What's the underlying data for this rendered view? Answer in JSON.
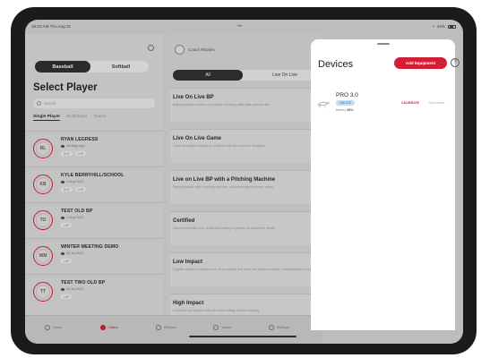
{
  "status_bar": {
    "time": "10:23 AM  Thu Aug 31",
    "wifi": "•",
    "battery": "44%"
  },
  "left": {
    "sport_toggle": [
      "Baseball",
      "Softball"
    ],
    "title": "Select Player",
    "search_placeholder": "Search",
    "filters": [
      "Single Player",
      "Multiplayer",
      "Teams"
    ],
    "players": [
      {
        "name": "RYAN LEGRESS",
        "meta": "44 days ago",
        "chips": [
          "RHP",
          "LHP"
        ]
      },
      {
        "name": "KYLE BERRYHILL/SCHOOL",
        "meta": "2 Aug 2023",
        "chips": [
          "RHP",
          "LHP"
        ]
      },
      {
        "name": "TEST OLD BP",
        "meta": "1 Aug 2023",
        "chips": [
          "LHP"
        ]
      },
      {
        "name": "WINTER MEETING DEMO",
        "meta": "25 Jul 2023",
        "chips": [
          "LHP"
        ]
      },
      {
        "name": "TEST TWO OLD BP",
        "meta": "24 Jul 2023",
        "chips": [
          "LHP"
        ]
      }
    ]
  },
  "mid": {
    "user": "Coach Rhodes",
    "tabs": [
      "All",
      "Live On Live"
    ],
    "modes": [
      {
        "title": "Live On Live BP",
        "desc": "Batting practice session vs a pitcher throwing, pitch data captured live"
      },
      {
        "title": "Live On Live Game",
        "desc": "Game-simulation session vs a pitcher with full count and situations"
      },
      {
        "title": "Live on Live BP with a Pitching Machine",
        "desc": "Batting practice with a pitching machine, outcomes captured each swing"
      },
      {
        "title": "Certified",
        "desc": "Swing certification test, a standard battery of pitches\nfor consistent results"
      },
      {
        "title": "Low Impact",
        "desc": "A lighter session to reduce load, fewer pitches and more rest\nbetween rounds, recommended during recovery periods"
      },
      {
        "title": "High Impact",
        "desc": "A full-intensity session with max effort swings and live tracking"
      }
    ]
  },
  "tab_bar": [
    "Home",
    "Hitters",
    "Pitchers",
    "Teams",
    "Settings"
  ],
  "devices": {
    "title": "Devices",
    "add_button": "Add Equipment",
    "help": "?",
    "device": {
      "name": "PRO 3.0",
      "badge": "ONLINE",
      "stats_label": "Battery",
      "stats_value": "98%",
      "action_primary": "CALIBRATE",
      "action_secondary": "Disconnect"
    }
  },
  "colors": {
    "accent": "#d41e35",
    "badge_bg": "#bfe0f3",
    "badge_text": "#2d7db3"
  }
}
